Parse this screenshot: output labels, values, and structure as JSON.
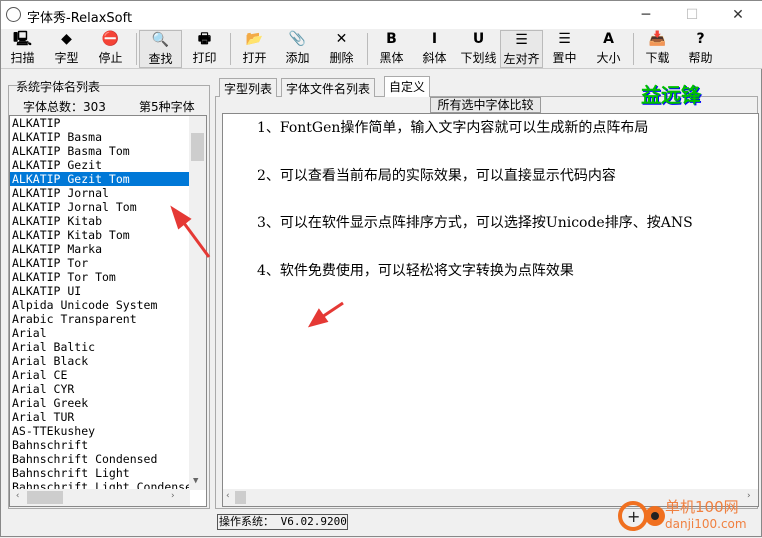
{
  "window": {
    "title": "字体秀-RelaxSoft",
    "minimize": "─",
    "maximize": "☐",
    "close": "✕"
  },
  "toolbar": [
    {
      "label": "扫描",
      "icon": "computer-icon",
      "glyph": "🖳"
    },
    {
      "label": "字型",
      "icon": "shapes-icon",
      "glyph": "◆"
    },
    {
      "label": "停止",
      "icon": "stop-icon",
      "glyph": "⛔"
    },
    {
      "label": "查找",
      "icon": "find-icon",
      "glyph": "🔍"
    },
    {
      "label": "打印",
      "icon": "printer-icon",
      "glyph": "🖶"
    },
    {
      "label": "打开",
      "icon": "folder-open-icon",
      "glyph": "📂"
    },
    {
      "label": "添加",
      "icon": "paperclip-icon",
      "glyph": "📎"
    },
    {
      "label": "删除",
      "icon": "delete-icon",
      "glyph": "✕"
    },
    {
      "label": "黑体",
      "icon": "bold-icon",
      "glyph": "B"
    },
    {
      "label": "斜体",
      "icon": "italic-icon",
      "glyph": "I"
    },
    {
      "label": "下划线",
      "icon": "underline-icon",
      "glyph": "U"
    },
    {
      "label": "左对齐",
      "icon": "align-left-icon",
      "glyph": "☰"
    },
    {
      "label": "置中",
      "icon": "align-center-icon",
      "glyph": "☰"
    },
    {
      "label": "大小",
      "icon": "font-size-icon",
      "glyph": "A"
    },
    {
      "label": "下载",
      "icon": "download-icon",
      "glyph": "📥"
    },
    {
      "label": "帮助",
      "icon": "help-icon",
      "glyph": "?"
    }
  ],
  "sidebar": {
    "group_title": "系统字体名列表",
    "total": "字体总数：303",
    "current": "第5种字体",
    "fonts": [
      "ALKATIP",
      "ALKATIP Basma",
      "ALKATIP Basma Tom",
      "ALKATIP Gezit",
      "ALKATIP Gezit Tom",
      "ALKATIP Jornal",
      "ALKATIP Jornal Tom",
      "ALKATIP Kitab",
      "ALKATIP Kitab Tom",
      "ALKATIP Marka",
      "ALKATIP Tor",
      "ALKATIP Tor Tom",
      "ALKATIP UI",
      "Alpida Unicode System",
      "Arabic Transparent",
      "Arial",
      "Arial Baltic",
      "Arial Black",
      "Arial CE",
      "Arial CYR",
      "Arial Greek",
      "Arial TUR",
      "AS-TTEkushey",
      "Bahnschrift",
      "Bahnschrift Condensed",
      "Bahnschrift Light",
      "Bahnschrift Light Condensed"
    ],
    "selected_index": 4
  },
  "tabs": [
    {
      "label": "字型列表"
    },
    {
      "label": "字体文件名列表"
    },
    {
      "label": "自定义",
      "active": true
    }
  ],
  "main": {
    "compare_button": "所有选中字体比较",
    "lines": [
      "1、FontGen操作简单，输入文字内容就可以生成新的点阵布局",
      "2、可以查看当前布局的实际效果，可以直接显示代码内容",
      "3、可以在软件显示点阵排序方式，可以选择按Unicode排序、按ANS",
      "4、软件免费使用，可以轻松将文字转换为点阵效果"
    ]
  },
  "logo_text": "益远锋",
  "status": "操作系统： V6.02.9200",
  "watermark": {
    "line1": "单机100网",
    "line2": "danji100.com"
  },
  "colors": {
    "selection": "#0078d7",
    "annotation_arrow": "#e53935",
    "logo": "#00c000"
  }
}
